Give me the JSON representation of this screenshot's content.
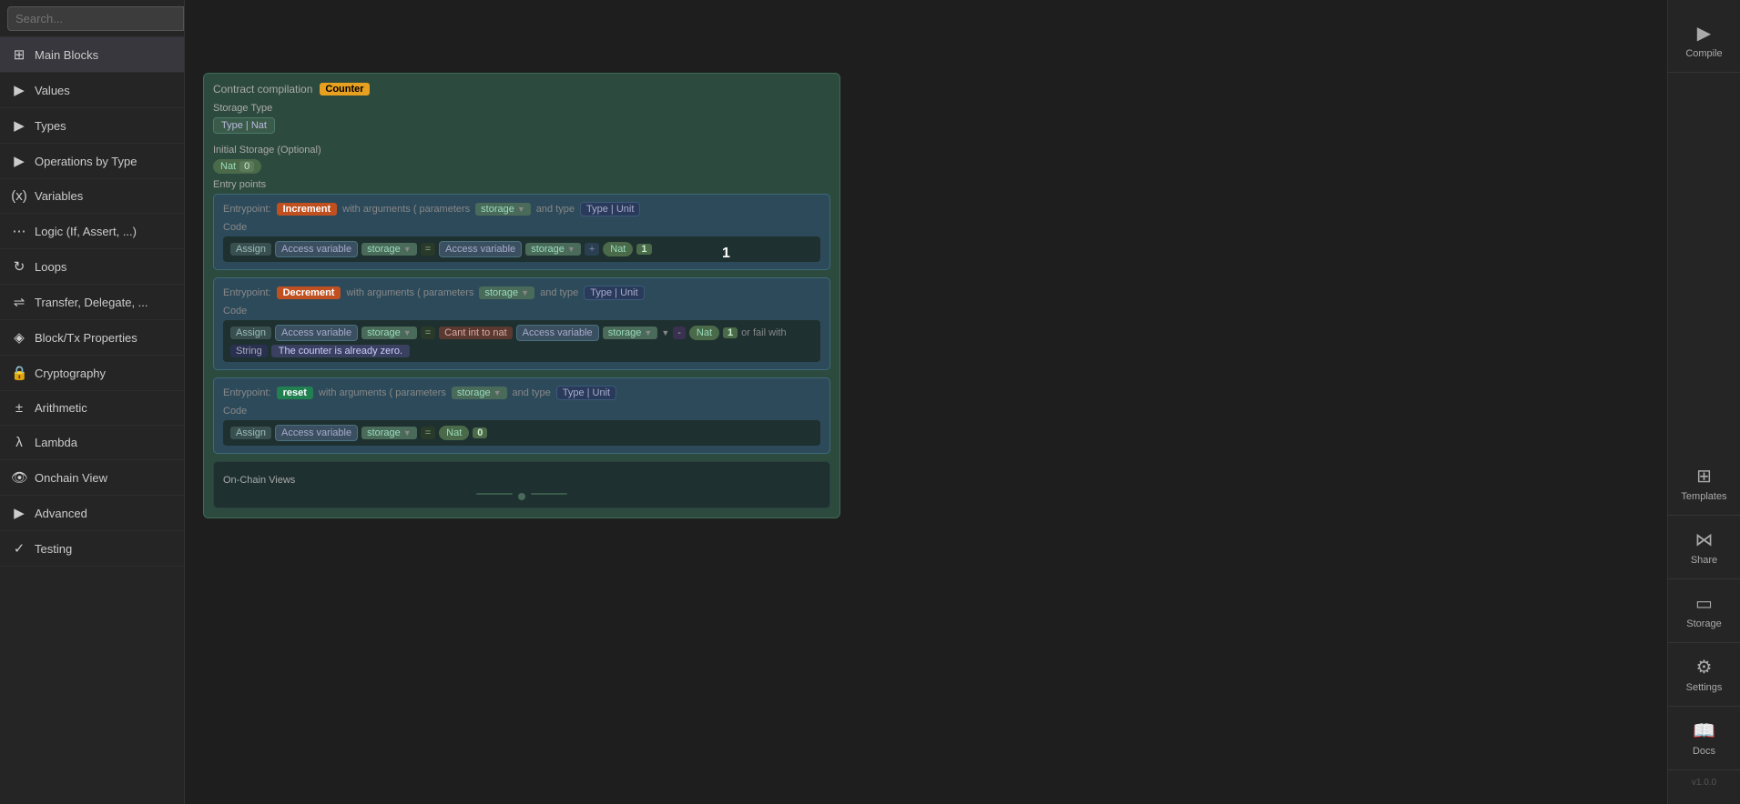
{
  "sidebar": {
    "search_placeholder": "Search...",
    "items": [
      {
        "id": "main-blocks",
        "label": "Main Blocks",
        "icon": "⊞",
        "type": "section"
      },
      {
        "id": "values",
        "label": "Values",
        "icon": "▶",
        "type": "expandable"
      },
      {
        "id": "types",
        "label": "Types",
        "icon": "▶",
        "type": "expandable"
      },
      {
        "id": "operations-by-type",
        "label": "Operations by Type",
        "icon": "▶",
        "type": "expandable"
      },
      {
        "id": "variables",
        "label": "Variables",
        "icon": "(x)",
        "type": "item"
      },
      {
        "id": "logic",
        "label": "Logic (If, Assert, ...)",
        "icon": "⋯",
        "type": "item"
      },
      {
        "id": "loops",
        "label": "Loops",
        "icon": "↻",
        "type": "item"
      },
      {
        "id": "transfer-delegate",
        "label": "Transfer, Delegate, ...",
        "icon": "⇌",
        "type": "item"
      },
      {
        "id": "block-tx",
        "label": "Block/Tx Properties",
        "icon": "◈",
        "type": "item"
      },
      {
        "id": "cryptography",
        "label": "Cryptography",
        "icon": "🔒",
        "type": "item"
      },
      {
        "id": "arithmetic",
        "label": "Arithmetic",
        "icon": "±",
        "type": "item"
      },
      {
        "id": "lambda",
        "label": "Lambda",
        "icon": "λ",
        "type": "item"
      },
      {
        "id": "onchain-view",
        "label": "Onchain View",
        "icon": "👁",
        "type": "item"
      },
      {
        "id": "advanced",
        "label": "Advanced",
        "icon": "▶",
        "type": "expandable"
      },
      {
        "id": "testing",
        "label": "Testing",
        "icon": "✓",
        "type": "item"
      }
    ]
  },
  "canvas": {
    "contract": {
      "compilation_label": "Contract compilation",
      "contract_name": "Counter",
      "storage_type_label": "Storage Type",
      "storage_type_value": "Type | Nat",
      "initial_storage_label": "Initial Storage (Optional)",
      "initial_storage_nat": "Nat",
      "initial_storage_num": "0",
      "entry_points_label": "Entry points",
      "entrypoints": [
        {
          "label": "Entrypoint:",
          "name": "Increment",
          "name_color": "ep-increment",
          "args_label": "with arguments (  parameters",
          "storage_label": "storage",
          "type_label": "and type",
          "type_value": "Type | Unit",
          "code_label": "Code",
          "assign_label": "Assign",
          "access_var1": "Access variable",
          "storage1": "storage",
          "equals": "=",
          "access_var2": "Access variable",
          "storage2": "storage",
          "plus": "+",
          "nat": "Nat",
          "num": "1"
        },
        {
          "label": "Entrypoint:",
          "name": "Decrement",
          "name_color": "ep-decrement",
          "args_label": "with arguments (  parameters",
          "storage_label": "storage",
          "type_label": "and type",
          "type_value": "Type | Unit",
          "code_label": "Code",
          "assign_label": "Assign",
          "access_var1": "Access variable",
          "storage1": "storage",
          "cant": "Cant int to nat",
          "access_var2": "Access variable",
          "storage2": "storage",
          "op": "or fail with",
          "string_label": "String",
          "string_value": "The counter is already zero.",
          "nat": "Nat",
          "num": "1"
        },
        {
          "label": "Entrypoint:",
          "name": "reset",
          "name_color": "ep-reset",
          "args_label": "with arguments (  parameters",
          "storage_label": "storage",
          "type_label": "and type",
          "type_value": "Type | Unit",
          "code_label": "Code",
          "assign_label": "Assign",
          "access_var1": "Access variable",
          "storage1": "storage",
          "equals": "=",
          "nat": "Nat",
          "num": "0"
        }
      ],
      "on_chain_label": "On-Chain Views",
      "canvas_number": "1"
    }
  },
  "right_panel": {
    "buttons": [
      {
        "id": "compile",
        "label": "Compile",
        "icon": "▶"
      },
      {
        "id": "templates",
        "label": "Templates",
        "icon": "⊞"
      },
      {
        "id": "share",
        "label": "Share",
        "icon": "⋈"
      },
      {
        "id": "storage",
        "label": "Storage",
        "icon": "▭"
      },
      {
        "id": "settings",
        "label": "Settings",
        "icon": "⚙"
      },
      {
        "id": "docs",
        "label": "Docs",
        "icon": "📖"
      }
    ],
    "version": "v1.0.0"
  }
}
